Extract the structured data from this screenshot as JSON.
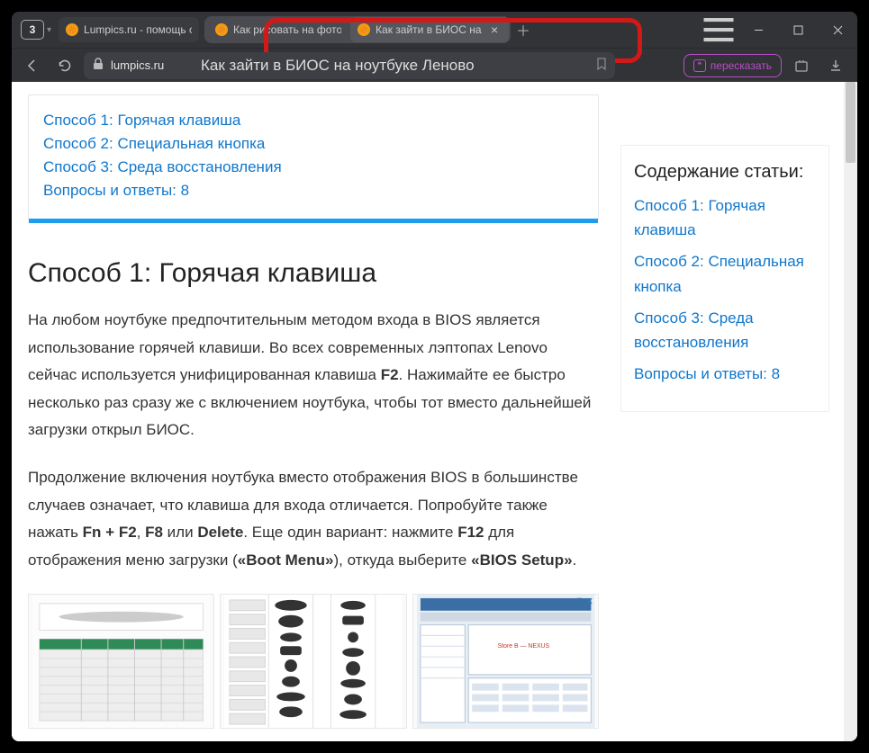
{
  "window": {
    "tab_count": "3",
    "tabs": [
      {
        "title": "Lumpics.ru - помощь с ко"
      },
      {
        "title": "Как рисовать на фото в B"
      },
      {
        "title": "Как зайти в БИОС на н"
      }
    ]
  },
  "url": {
    "domain": "lumpics.ru",
    "title_overlay": "Как зайти в БИОС на ноутбуке Леново"
  },
  "buttons": {
    "retell": "пересказать"
  },
  "toc": {
    "items": [
      "Способ 1: Горячая клавиша",
      "Способ 2: Специальная кнопка",
      "Способ 3: Среда восстановления",
      "Вопросы и ответы: 8"
    ]
  },
  "article": {
    "h2": "Способ 1: Горячая клавиша",
    "p1_a": "На любом ноутбуке предпочтительным методом входа в BIOS является использование горячей клавиши. Во всех современных лэптопах Lenovo сейчас используется унифицированная клавиша ",
    "p1_b": "F2",
    "p1_c": ". Нажимайте ее быстро несколько раз сразу же с включением ноутбука, чтобы тот вместо дальнейшей загрузки открыл БИОС.",
    "p2_a": "Продолжение включения ноутбука вместо отображения BIOS в большинстве случаев означает, что клавиша для входа отличается. Попробуйте также нажать ",
    "p2_b": "Fn + F2",
    "p2_c": ", ",
    "p2_d": "F8",
    "p2_e": " или ",
    "p2_f": "Delete",
    "p2_g": ". Еще один вариант: нажмите ",
    "p2_h": "F12",
    "p2_i": " для отображения меню загрузки (",
    "p2_j": "«Boot Menu»",
    "p2_k": "), откуда выберите ",
    "p2_l": "«BIOS Setup»",
    "p2_m": "."
  },
  "side": {
    "heading": "Содержание статьи:",
    "items": [
      "Способ 1: Горячая клавиша",
      "Способ 2: Специальная кнопка",
      "Способ 3: Среда восстановления",
      "Вопросы и ответы: 8"
    ]
  },
  "ads": {
    "info": "ⓘ",
    "close": "✕"
  }
}
